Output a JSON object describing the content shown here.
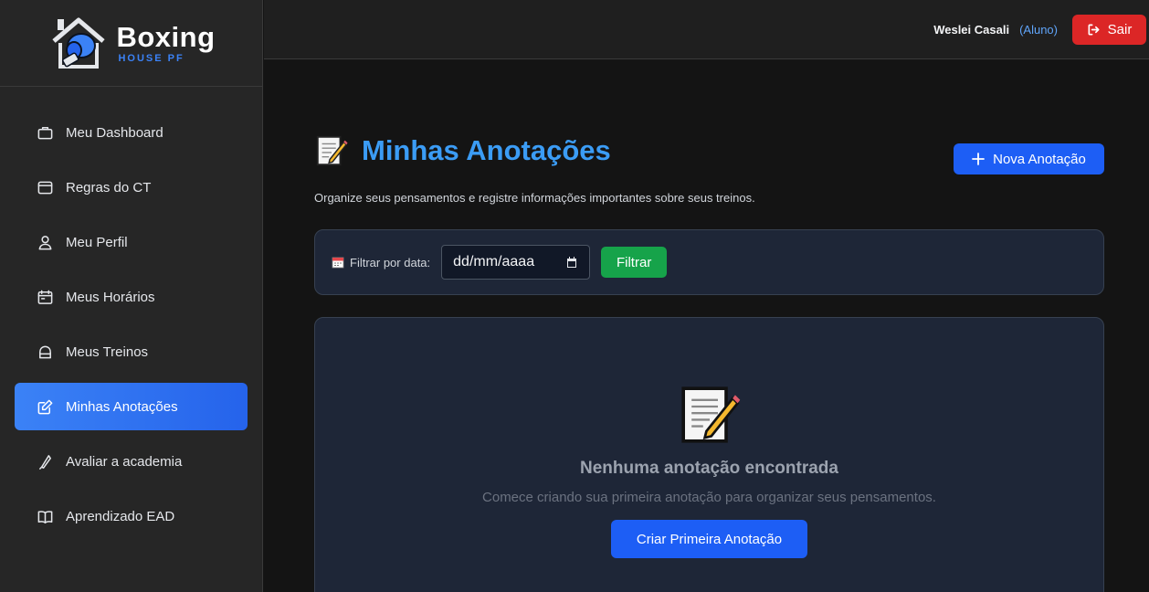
{
  "brand": {
    "title": "Boxing",
    "subtitle": "HOUSE PF"
  },
  "sidebar": {
    "items": [
      {
        "label": "Meu Dashboard",
        "icon": "briefcase-icon",
        "active": false
      },
      {
        "label": "Regras do CT",
        "icon": "window-icon",
        "active": false
      },
      {
        "label": "Meu Perfil",
        "icon": "user-icon",
        "active": false
      },
      {
        "label": "Meus Horários",
        "icon": "calendar-icon",
        "active": false
      },
      {
        "label": "Meus Treinos",
        "icon": "dumbbell-icon",
        "active": false
      },
      {
        "label": "Minhas Anotações",
        "icon": "edit-icon",
        "active": true
      },
      {
        "label": "Avaliar a academia",
        "icon": "feather-icon",
        "active": false
      },
      {
        "label": "Aprendizado EAD",
        "icon": "book-open-icon",
        "active": false
      }
    ]
  },
  "topbar": {
    "user_name": "Weslei Casali",
    "user_role": "(Aluno)",
    "logout_label": "Sair",
    "logout_icon": "logout-icon"
  },
  "page": {
    "title": "Minhas Anotações",
    "title_icon": "memo-icon",
    "subtitle": "Organize seus pensamentos e registre informações importantes sobre seus treinos.",
    "new_button": "Nova Anotação"
  },
  "filter": {
    "label": "Filtrar por data:",
    "date_value": "dd/mm/aaaa",
    "button": "Filtrar"
  },
  "empty_state": {
    "title": "Nenhuma anotação encontrada",
    "description": "Comece criando sua primeira anotação para organizar seus pensamentos.",
    "button": "Criar Primeira Anotação"
  },
  "colors": {
    "accent": "#3b82f6",
    "danger": "#dc2626",
    "success": "#16a34a",
    "card": "#1e2637"
  }
}
